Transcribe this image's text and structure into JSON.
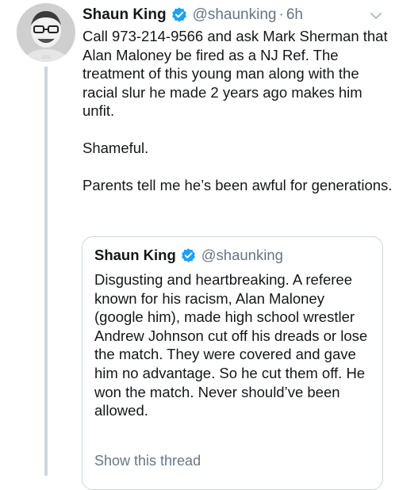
{
  "tweet": {
    "author_name": "Shaun King",
    "author_handle": "@shaunking",
    "separator": "·",
    "timestamp": "6h",
    "body": "Call 973-214-9566 and ask Mark Sherman that Alan Maloney be fired as a NJ Ref. The treatment of this young man along with the racial slur he made 2 years ago makes him unfit.\n\nShameful.\n\nParents tell me he’s been awful for generations."
  },
  "quoted_tweet": {
    "author_name": "Shaun King",
    "author_handle": "@shaunking",
    "body": "Disgusting and heartbreaking. A referee known for his racism, Alan Maloney (google him), made high school wrestler Andrew Johnson cut off his dreads or lose the match. They were covered and gave him no advantage. So he cut them off. He won the match. Never should’ve been allowed.",
    "show_thread_label": "Show this thread"
  },
  "colors": {
    "verified_badge": "#1da1f2",
    "secondary_text": "#657786",
    "border": "#ccd6dd",
    "primary_text": "#14171a"
  },
  "icons": {
    "avatar": "avatar",
    "verified": "verified-badge-icon",
    "menu": "chevron-down-icon"
  }
}
